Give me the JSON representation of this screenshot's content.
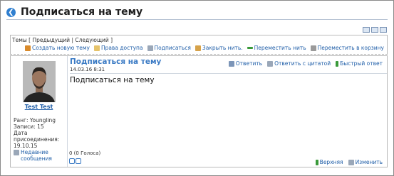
{
  "page": {
    "title": "Подписаться на тему"
  },
  "nav": {
    "topics": "Темы",
    "previous": "Предыдущий",
    "next": "Следующий"
  },
  "toolbar": {
    "new_topic": "Создать новую тему",
    "access_rights": "Права доступа",
    "subscribe": "Подписаться",
    "close_thread": "Закрыть нить.",
    "move_thread": "Переместить нить",
    "move_to_trash": "Переместить в корзину"
  },
  "author": {
    "name": "Test Test",
    "rank_label": "Ранг:",
    "rank": "Youngling",
    "posts_label": "Записи:",
    "posts": "15",
    "joined_label_1": "Дата",
    "joined_label_2": "присоединения:",
    "joined": "19.10.15",
    "recent_1": "Недавние",
    "recent_2": "сообщения"
  },
  "post": {
    "title": "Подписаться на тему",
    "date": "14.03.16 8:31",
    "reply": "Ответить",
    "reply_quote": "Ответить с цитатой",
    "quick_reply": "Быстрый ответ",
    "text": "Подписаться на тему",
    "votes": "0 (0 Голоса)",
    "top": "Верхняя",
    "edit": "Изменить"
  }
}
